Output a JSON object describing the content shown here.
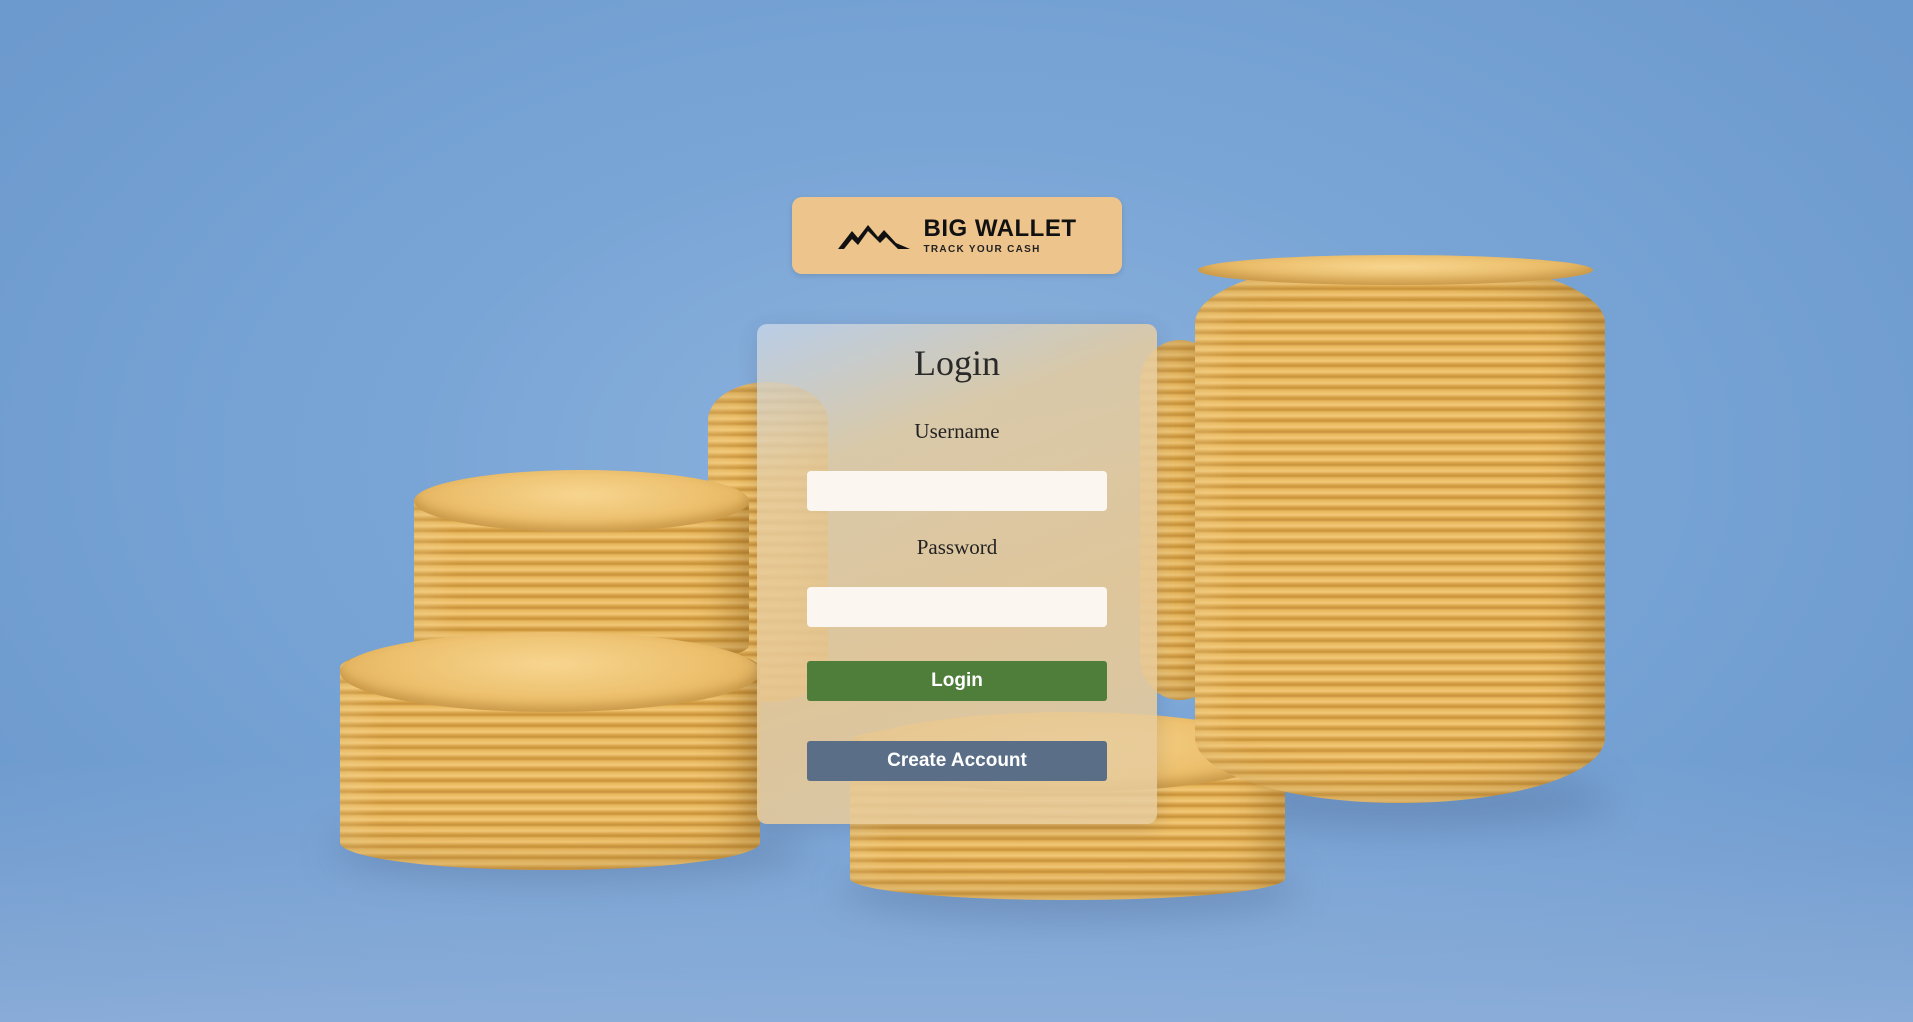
{
  "logo": {
    "title": "BIG WALLET",
    "tagline": "TRACK YOUR CASH",
    "icon": "mountains-icon"
  },
  "login_form": {
    "title": "Login",
    "username_label": "Username",
    "username_value": "",
    "password_label": "Password",
    "password_value": "",
    "login_button": "Login",
    "create_account_button": "Create Account"
  },
  "colors": {
    "background": "#79a5d6",
    "logo_background": "#eec48d",
    "login_button": "#4f7e3a",
    "create_account_button": "#5a6e88"
  }
}
